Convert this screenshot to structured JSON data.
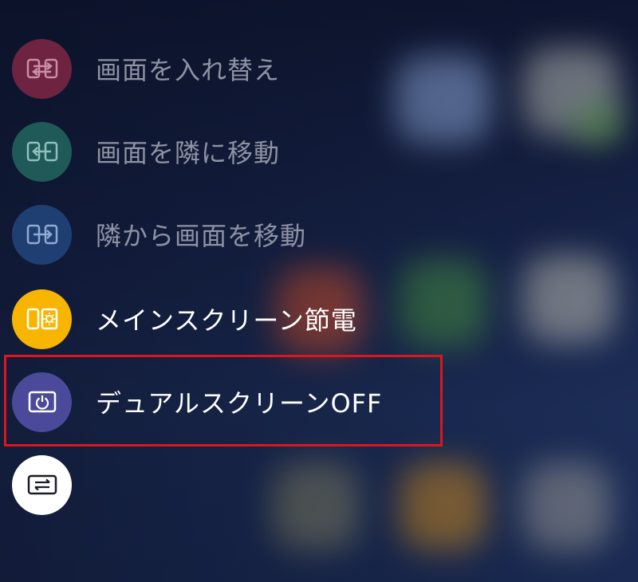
{
  "colors": {
    "swap_icon_bg": "#6e2440",
    "move_to_icon_bg": "#1f5a58",
    "move_from_icon_bg": "#1f3f72",
    "power_saving_icon_bg": "#f8b500",
    "dual_off_icon_bg": "#4b4a9a",
    "last_icon_bg": "#ffffff",
    "highlight_border": "#e0141c"
  },
  "menu": {
    "items": [
      {
        "label": "画面を入れ替え",
        "icon": "swap-screens-icon",
        "enabled": false
      },
      {
        "label": "画面を隣に移動",
        "icon": "move-to-adjacent-icon",
        "enabled": false
      },
      {
        "label": "隣から画面を移動",
        "icon": "move-from-adjacent-icon",
        "enabled": false
      },
      {
        "label": "メインスクリーン節電",
        "icon": "main-screen-power-saving-icon",
        "enabled": true
      },
      {
        "label": "デュアルスクリーンOFF",
        "icon": "dual-screen-off-icon",
        "enabled": true
      },
      {
        "label": "",
        "icon": "screen-toggle-icon",
        "enabled": true
      }
    ]
  }
}
